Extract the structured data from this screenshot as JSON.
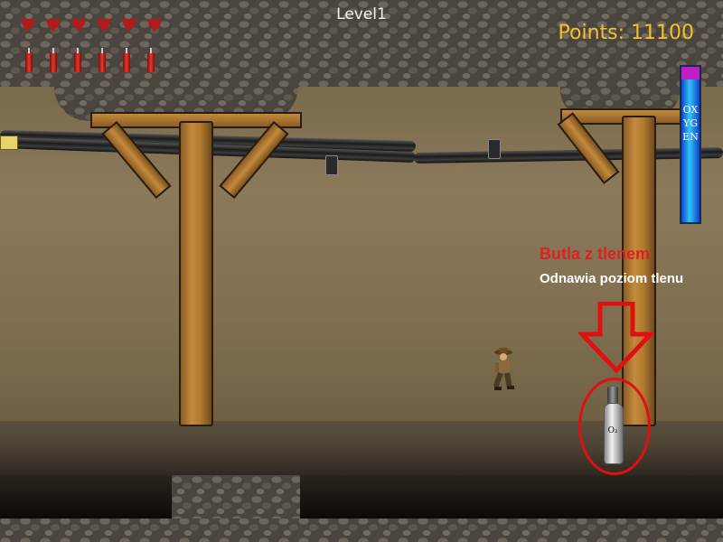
{
  "hud": {
    "lives": 6,
    "dynamite": 6,
    "level_label": "Level1",
    "points_label": "Points: 11100",
    "oxygen_label": "OXYGEN",
    "oxygen_level": 0.92
  },
  "tooltip": {
    "title": "Butla z tlenem",
    "subtitle": "Odnawia poziom tlenu"
  },
  "item": {
    "label": "O₂"
  },
  "colors": {
    "heart": "#b41a1a",
    "points": "#f2c02b",
    "tooltip_title": "#e02020",
    "highlight": "#e01010",
    "oxygen_bar": "#33c6f2",
    "oxygen_cap": "#c020c8"
  }
}
